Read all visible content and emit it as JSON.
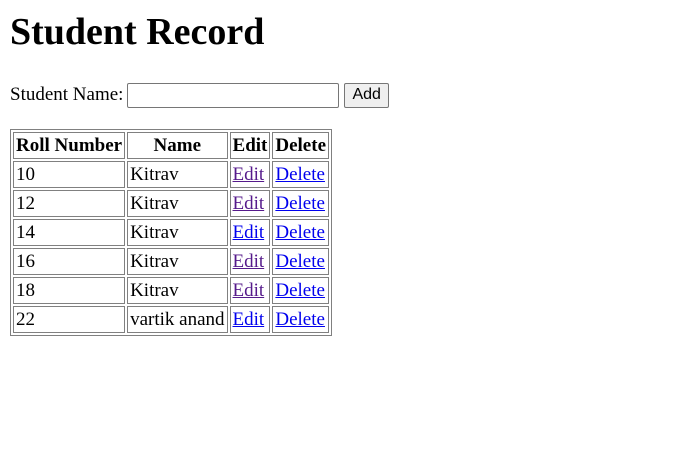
{
  "page": {
    "title": "Student Record"
  },
  "form": {
    "label": "Student Name:",
    "input_value": "",
    "input_placeholder": "",
    "add_label": "Add"
  },
  "table": {
    "headers": [
      "Roll Number",
      "Name",
      "Edit",
      "Delete"
    ],
    "rows": [
      {
        "roll": "10",
        "name": "Kitrav",
        "edit": "Edit",
        "delete": "Delete",
        "edit_visited": true
      },
      {
        "roll": "12",
        "name": "Kitrav",
        "edit": "Edit",
        "delete": "Delete",
        "edit_visited": true
      },
      {
        "roll": "14",
        "name": "Kitrav",
        "edit": "Edit",
        "delete": "Delete",
        "edit_visited": false
      },
      {
        "roll": "16",
        "name": "Kitrav",
        "edit": "Edit",
        "delete": "Delete",
        "edit_visited": true
      },
      {
        "roll": "18",
        "name": "Kitrav",
        "edit": "Edit",
        "delete": "Delete",
        "edit_visited": true
      },
      {
        "roll": "22",
        "name": "vartik anand",
        "edit": "Edit",
        "delete": "Delete",
        "edit_visited": false
      }
    ]
  },
  "colors": {
    "link": "#0000ee",
    "visited_link": "#551a8b"
  }
}
